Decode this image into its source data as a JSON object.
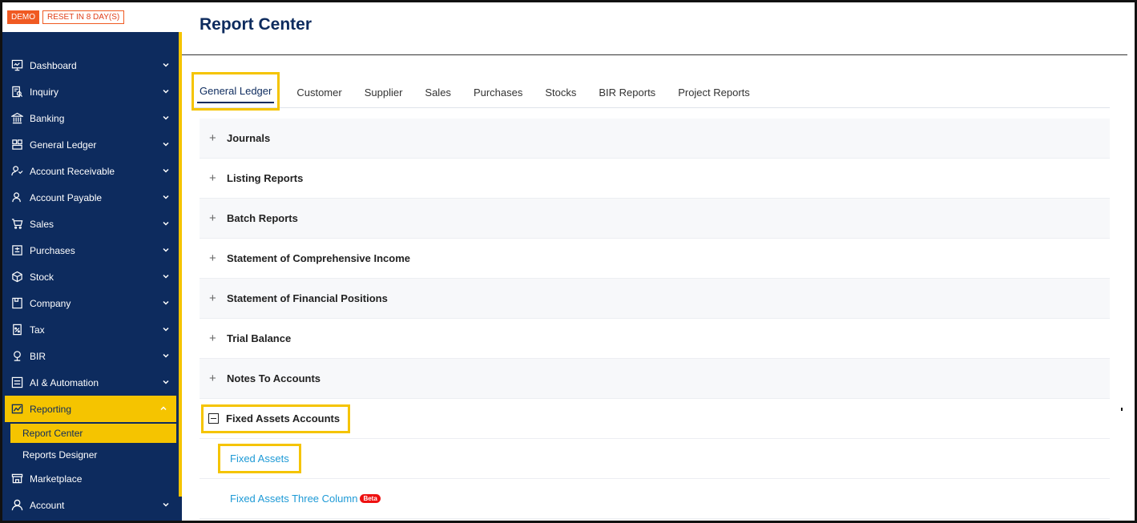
{
  "banner": {
    "demo": "DEMO",
    "reset": "RESET IN 8 DAY(S)"
  },
  "sidebar": {
    "items": [
      {
        "label": "Dashboard",
        "icon": "dashboard-icon"
      },
      {
        "label": "Inquiry",
        "icon": "inquiry-icon"
      },
      {
        "label": "Banking",
        "icon": "bank-icon"
      },
      {
        "label": "General Ledger",
        "icon": "ledger-icon"
      },
      {
        "label": "Account Receivable",
        "icon": "receivable-icon"
      },
      {
        "label": "Account Payable",
        "icon": "payable-icon"
      },
      {
        "label": "Sales",
        "icon": "sales-icon"
      },
      {
        "label": "Purchases",
        "icon": "purchases-icon"
      },
      {
        "label": "Stock",
        "icon": "stock-icon"
      },
      {
        "label": "Company",
        "icon": "company-icon"
      },
      {
        "label": "Tax",
        "icon": "tax-icon"
      },
      {
        "label": "BIR",
        "icon": "bir-icon"
      },
      {
        "label": "AI & Automation",
        "icon": "automation-icon"
      },
      {
        "label": "Reporting",
        "icon": "reporting-icon"
      }
    ],
    "sub_items": [
      "Report Center",
      "Reports Designer"
    ],
    "after_items": [
      {
        "label": "Marketplace",
        "icon": "marketplace-icon"
      },
      {
        "label": "Account",
        "icon": "account-icon"
      }
    ]
  },
  "page": {
    "title": "Report Center"
  },
  "tabs": [
    "General Ledger",
    "Customer",
    "Supplier",
    "Sales",
    "Purchases",
    "Stocks",
    "BIR Reports",
    "Project Reports"
  ],
  "sections": [
    "Journals",
    "Listing Reports",
    "Batch Reports",
    "Statement of Comprehensive Income",
    "Statement of Financial Positions",
    "Trial Balance",
    "Notes To Accounts"
  ],
  "open_section": {
    "label": "Fixed Assets Accounts",
    "links": [
      "Fixed Assets",
      "Fixed Assets Three Column"
    ],
    "beta": "Beta"
  },
  "colors": {
    "sidebar": "#0d2b5e",
    "highlight": "#f5c400",
    "link": "#1e9ad6",
    "demo": "#f05a22"
  }
}
